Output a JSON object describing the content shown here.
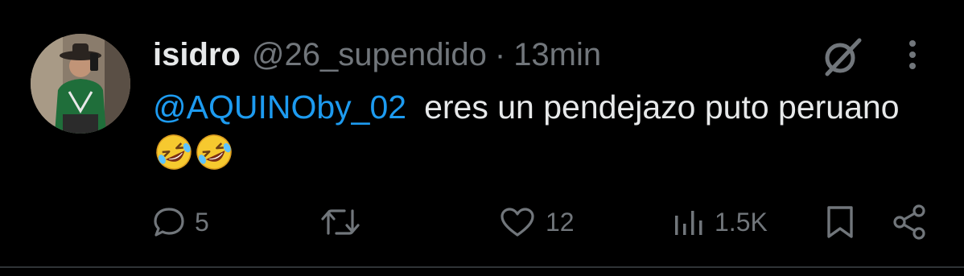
{
  "tweet": {
    "author_name": "isidro",
    "author_handle": "@26_supendido",
    "separator": "·",
    "time": "13min",
    "mention": "@AQUINOby_02",
    "text": "eres un pendejazo puto peruano",
    "emoji": [
      "rolling-on-floor-laughing-emoji",
      "rolling-on-floor-laughing-emoji"
    ]
  },
  "actions": {
    "replies": "5",
    "likes": "12",
    "views": "1.5K"
  },
  "colors": {
    "background": "#000000",
    "text": "#e7e9ea",
    "muted": "#71767b",
    "link": "#1d9bf0"
  }
}
